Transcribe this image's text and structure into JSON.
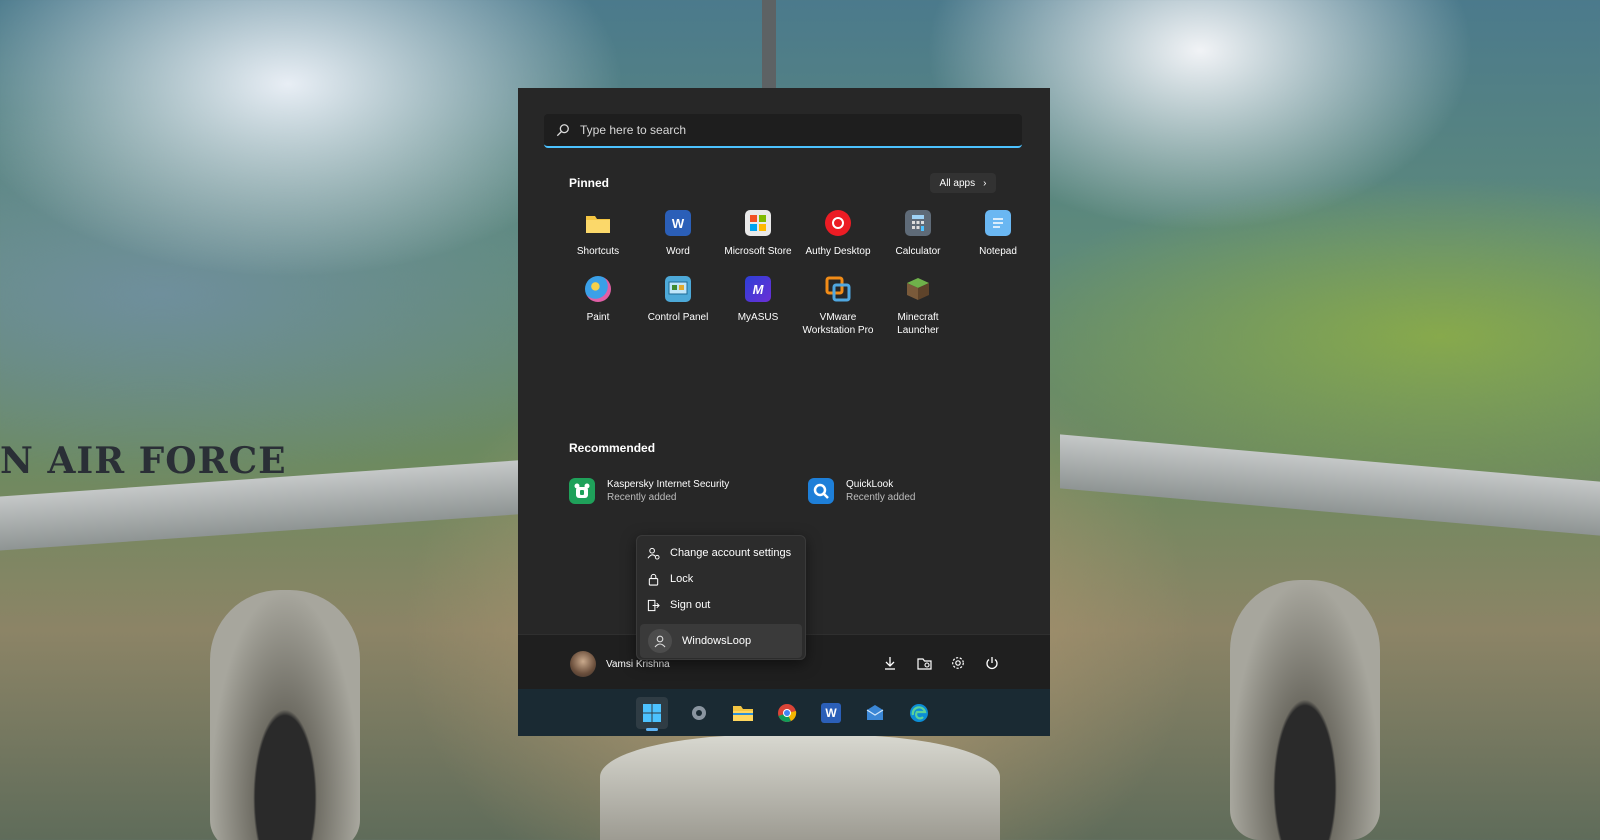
{
  "wallpaper": {
    "text": "N AIR FORCE"
  },
  "search": {
    "placeholder": "Type here to search"
  },
  "pinned": {
    "title": "Pinned",
    "all_apps_label": "All apps",
    "apps": [
      {
        "label": "Shortcuts",
        "icon": "folder-icon",
        "color": "#f4c542"
      },
      {
        "label": "Word",
        "icon": "word-icon",
        "color": "#2b5fb8"
      },
      {
        "label": "Microsoft Store",
        "icon": "store-icon",
        "color": "#e9e9e9"
      },
      {
        "label": "Authy Desktop",
        "icon": "authy-icon",
        "color": "#ec1c24"
      },
      {
        "label": "Calculator",
        "icon": "calculator-icon",
        "color": "#5f6b78"
      },
      {
        "label": "Notepad",
        "icon": "notepad-icon",
        "color": "#6ab7f2"
      },
      {
        "label": "Paint",
        "icon": "paint-icon",
        "color": "#3aa0e8"
      },
      {
        "label": "Control Panel",
        "icon": "control-panel-icon",
        "color": "#4da9d8"
      },
      {
        "label": "MyASUS",
        "icon": "myasus-icon",
        "color": "#2c3fd6"
      },
      {
        "label": "VMware Workstation Pro",
        "icon": "vmware-icon",
        "color": "#f28c17"
      },
      {
        "label": "Minecraft Launcher",
        "icon": "minecraft-icon",
        "color": "#5b8a3a"
      }
    ]
  },
  "recommended": {
    "title": "Recommended",
    "items": [
      {
        "name": "Kaspersky Internet Security",
        "sub": "Recently added",
        "icon": "kaspersky-icon"
      },
      {
        "name": "QuickLook",
        "sub": "Recently added",
        "icon": "quicklook-icon"
      }
    ]
  },
  "account_menu": {
    "items": [
      {
        "label": "Change account settings",
        "icon": "account-settings-icon"
      },
      {
        "label": "Lock",
        "icon": "lock-icon"
      },
      {
        "label": "Sign out",
        "icon": "sign-out-icon"
      }
    ],
    "other_user": "WindowsLoop"
  },
  "footer": {
    "user_name": "Vamsi Krishna",
    "icons": [
      "downloads-icon",
      "file-explorer-folder-icon",
      "settings-gear-icon",
      "power-icon"
    ]
  },
  "taskbar": {
    "icons": [
      "windows-start-icon",
      "settings-icon",
      "file-explorer-icon",
      "chrome-icon",
      "word-icon",
      "mail-icon",
      "edge-icon"
    ],
    "accent": "#5fb2f2"
  }
}
